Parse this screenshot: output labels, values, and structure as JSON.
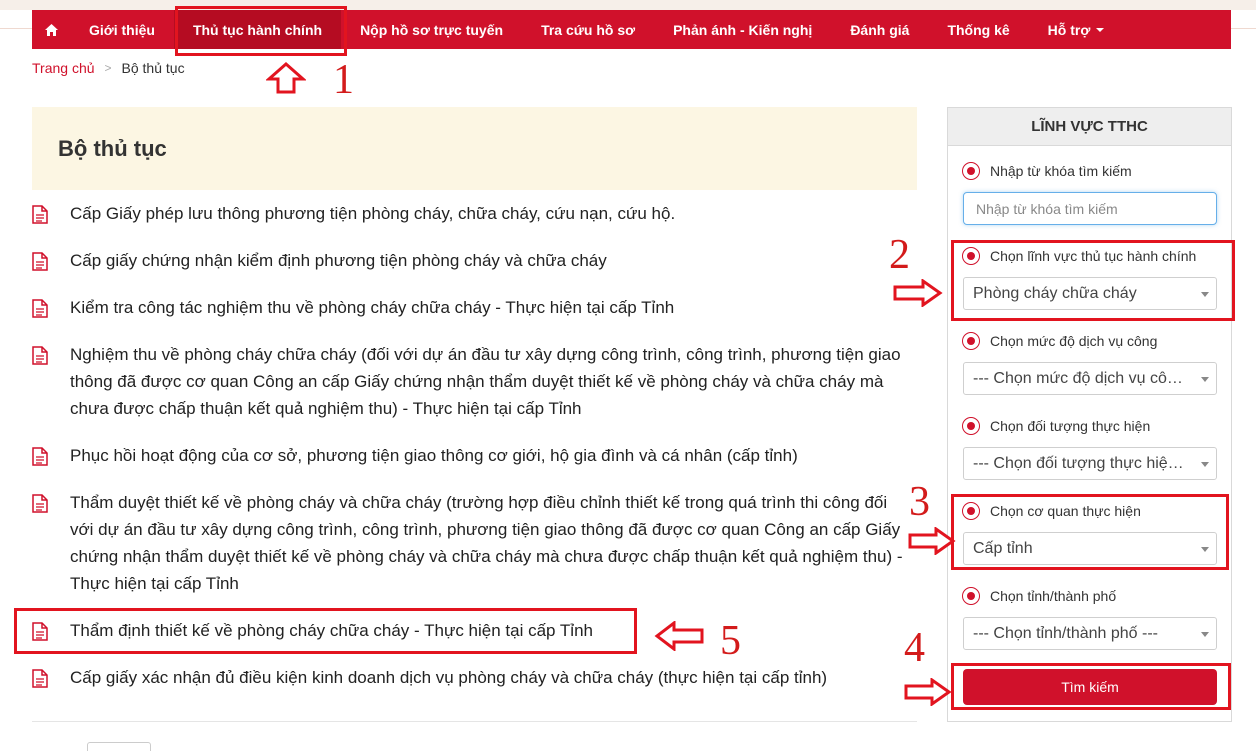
{
  "nav": {
    "home_icon": "home-icon",
    "items": [
      {
        "label": "Giới thiệu"
      },
      {
        "label": "Thủ tục hành chính"
      },
      {
        "label": "Nộp hồ sơ trực tuyến"
      },
      {
        "label": "Tra cứu hồ sơ"
      },
      {
        "label": "Phản ánh - Kiến nghị"
      },
      {
        "label": "Đánh giá"
      },
      {
        "label": "Thống kê"
      },
      {
        "label": "Hỗ trợ"
      }
    ],
    "active_index": 1
  },
  "breadcrumb": {
    "home": "Trang chủ",
    "separator": ">",
    "current": "Bộ thủ tục"
  },
  "page_title": "Bộ thủ tục",
  "procedures": [
    {
      "text": "Cấp Giấy phép lưu thông phương tiện phòng cháy, chữa cháy, cứu nạn, cứu hộ."
    },
    {
      "text": "Cấp giấy chứng nhận kiểm định phương tiện phòng cháy và chữa cháy"
    },
    {
      "text": "Kiểm tra công tác nghiệm thu về phòng cháy chữa cháy - Thực hiện tại cấp Tỉnh"
    },
    {
      "text": "Nghiệm thu về phòng cháy chữa cháy (đối với dự án đầu tư xây dựng công trình, công trình, phương tiện giao thông đã được cơ quan Công an cấp Giấy chứng nhận thẩm duyệt thiết kế về phòng cháy và chữa cháy mà chưa được chấp thuận kết quả nghiệm thu) - Thực hiện tại cấp Tỉnh"
    },
    {
      "text": "Phục hồi hoạt động của cơ sở, phương tiện giao thông cơ giới, hộ gia đình và cá nhân (cấp tỉnh)"
    },
    {
      "text": "Thẩm duyệt thiết kế về phòng cháy và chữa cháy (trường hợp điều chỉnh thiết kế trong quá trình thi công đối với dự án đầu tư xây dựng công trình, công trình, phương tiện giao thông đã được cơ quan Công an cấp Giấy chứng nhận thẩm duyệt thiết kế về phòng cháy và chữa cháy mà chưa được chấp thuận kết quả nghiệm thu) - Thực hiện tại cấp Tỉnh"
    },
    {
      "text": "Thẩm định thiết kế về phòng cháy chữa cháy - Thực hiện tại cấp Tỉnh"
    },
    {
      "text": "Cấp giấy xác nhận đủ điều kiện kinh doanh dịch vụ phòng cháy và chữa cháy (thực hiện tại cấp tỉnh)"
    }
  ],
  "sidebar": {
    "title": "LĨNH VỰC TTHC",
    "keyword": {
      "label": "Nhập từ khóa tìm kiếm",
      "placeholder": "Nhập từ khóa tìm kiếm",
      "value": ""
    },
    "field": {
      "label": "Chọn lĩnh vực thủ tục hành chính",
      "selected": "Phòng cháy chữa cháy"
    },
    "service_level": {
      "label": "Chọn mức độ dịch vụ công",
      "selected": "--- Chọn mức độ dịch vụ công ---"
    },
    "target": {
      "label": "Chọn đối tượng thực hiện",
      "selected": "--- Chọn đối tượng thực hiện ---"
    },
    "agency": {
      "label": "Chọn cơ quan thực hiện",
      "selected": "Cấp tỉnh"
    },
    "province": {
      "label": "Chọn tỉnh/thành phố",
      "selected": "--- Chọn tỉnh/thành phố ---"
    },
    "search_button": "Tìm kiếm"
  },
  "annotations": [
    "1",
    "2",
    "3",
    "4",
    "5"
  ],
  "colors": {
    "brand_red": "#d0112b",
    "highlight_red": "#e2141f",
    "title_bg": "#fcf6e3"
  }
}
